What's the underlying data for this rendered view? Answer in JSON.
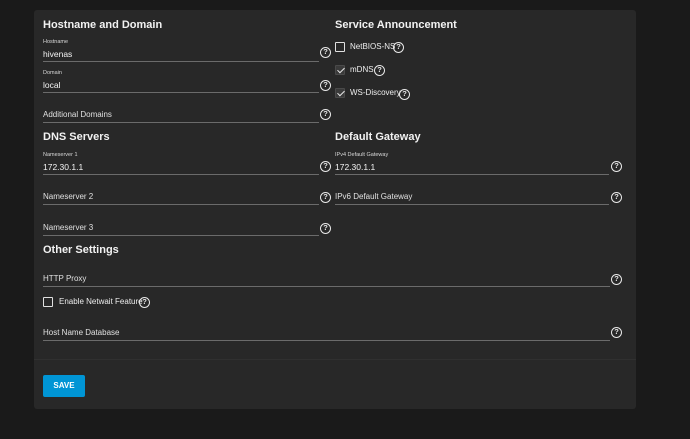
{
  "sections": {
    "hostname_domain": "Hostname and Domain",
    "dns_servers": "DNS Servers",
    "other_settings": "Other Settings",
    "service_announcement": "Service Announcement",
    "default_gateway": "Default Gateway"
  },
  "fields": {
    "hostname": {
      "label": "Hostname",
      "value": "hivenas"
    },
    "domain": {
      "label": "Domain",
      "value": "local"
    },
    "additional_domains": {
      "placeholder": "Additional Domains"
    },
    "nameserver1": {
      "label": "Nameserver 1",
      "value": "172.30.1.1"
    },
    "nameserver2": {
      "placeholder": "Nameserver 2"
    },
    "nameserver3": {
      "placeholder": "Nameserver 3"
    },
    "ipv4_gateway": {
      "label": "IPv4 Default Gateway",
      "value": "172.30.1.1"
    },
    "ipv6_gateway": {
      "placeholder": "IPv6 Default Gateway"
    },
    "http_proxy": {
      "placeholder": "HTTP Proxy"
    },
    "host_name_database": {
      "placeholder": "Host Name Database"
    }
  },
  "checkboxes": {
    "netbios_ns": {
      "label": "NetBIOS-NS",
      "checked": false
    },
    "mdns": {
      "label": "mDNS",
      "checked": true
    },
    "ws_discovery": {
      "label": "WS-Discovery",
      "checked": true
    },
    "netwait": {
      "label": "Enable Netwait Feature",
      "checked": false
    }
  },
  "help_glyph": "?",
  "buttons": {
    "save": "SAVE"
  },
  "colors": {
    "accent": "#0095d5",
    "card": "#282828",
    "background": "#1a1a1a"
  }
}
